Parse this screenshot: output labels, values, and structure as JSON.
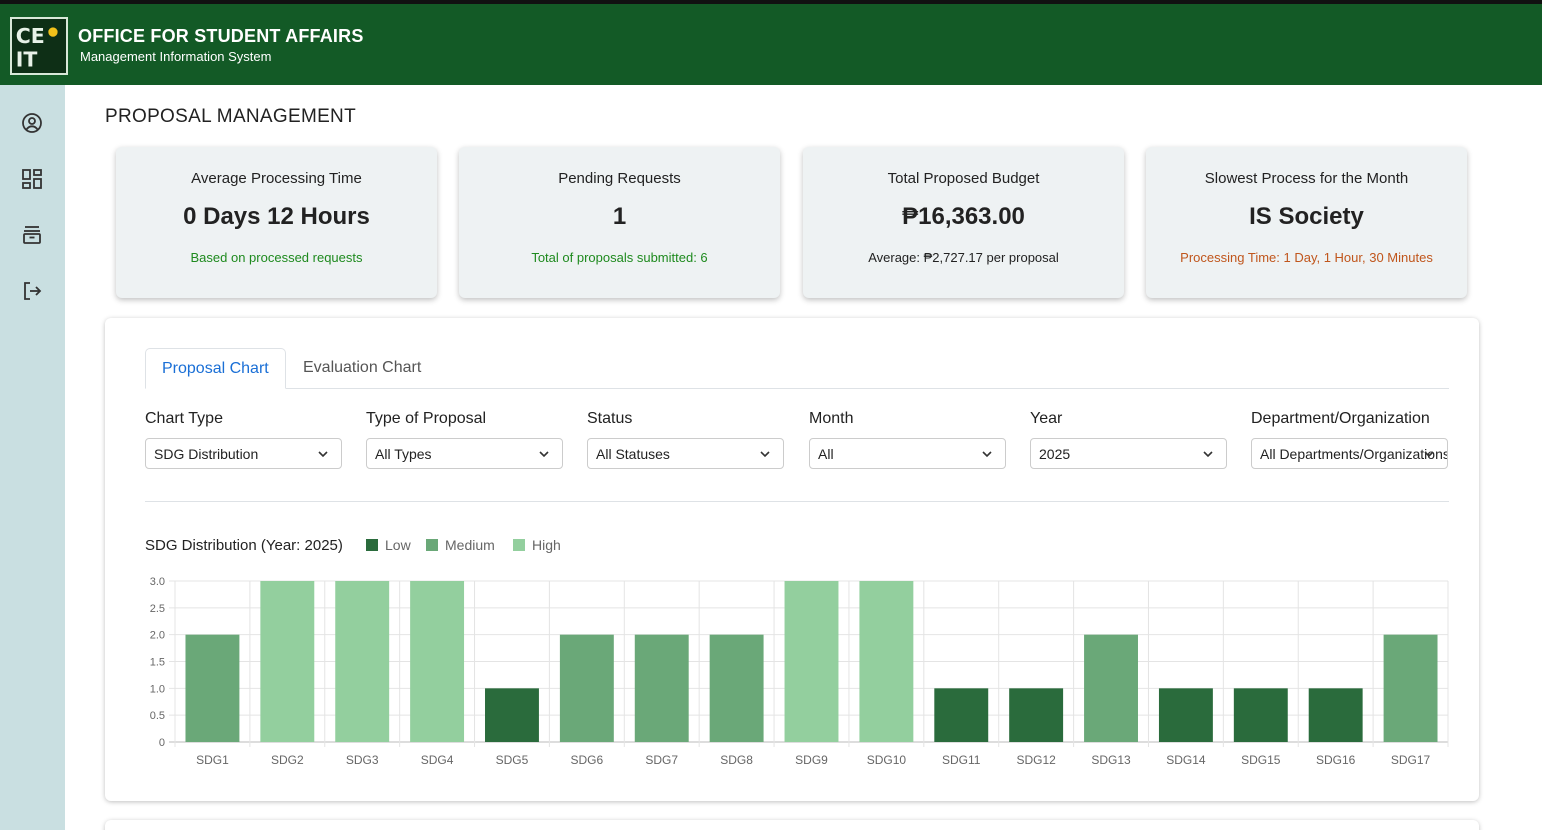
{
  "header": {
    "title": "OFFICE FOR STUDENT AFFAIRS",
    "subtitle": "Management Information System",
    "logo_text": "CEIT"
  },
  "sidebar": {
    "items": [
      {
        "icon": "user-circle-icon"
      },
      {
        "icon": "dashboard-grid-icon"
      },
      {
        "icon": "archive-box-icon"
      },
      {
        "icon": "logout-icon"
      }
    ]
  },
  "page": {
    "title": "PROPOSAL MANAGEMENT"
  },
  "cards": [
    {
      "label": "Average Processing Time",
      "value": "0 Days 12 Hours",
      "note": "Based on processed requests",
      "note_color": "#1e8a1e"
    },
    {
      "label": "Pending Requests",
      "value": "1",
      "note": "Total of proposals submitted: 6",
      "note_color": "#1e8a1e"
    },
    {
      "label": "Total Proposed Budget",
      "value": "₱16,363.00",
      "note": "Average: ₱2,727.17 per proposal",
      "note_color": "#222222"
    },
    {
      "label": "Slowest Process for the Month",
      "value": "IS Society",
      "note": "Processing Time: 1 Day, 1 Hour, 30 Minutes",
      "note_color": "#c0561c"
    }
  ],
  "tabs": [
    {
      "label": "Proposal Chart",
      "active": true
    },
    {
      "label": "Evaluation Chart",
      "active": false
    }
  ],
  "filters": [
    {
      "label": "Chart Type",
      "value": "SDG Distribution"
    },
    {
      "label": "Type of Proposal",
      "value": "All Types"
    },
    {
      "label": "Status",
      "value": "All Statuses"
    },
    {
      "label": "Month",
      "value": "All"
    },
    {
      "label": "Year",
      "value": "2025"
    },
    {
      "label": "Department/Organization",
      "value": "All Departments/Organizations"
    }
  ],
  "colors": {
    "header_bg": "#135a26",
    "sidebar_bg": "#c9dfe1",
    "active_tab": "#1a6fd6"
  },
  "chart_data": {
    "type": "bar",
    "title": "SDG Distribution (Year: 2025)",
    "legend_position": "top",
    "series_legend": [
      {
        "name": "Low",
        "color": "#2a6b3c"
      },
      {
        "name": "Medium",
        "color": "#6aa878"
      },
      {
        "name": "High",
        "color": "#93cf9e"
      }
    ],
    "categories": [
      "SDG1",
      "SDG2",
      "SDG3",
      "SDG4",
      "SDG5",
      "SDG6",
      "SDG7",
      "SDG8",
      "SDG9",
      "SDG10",
      "SDG11",
      "SDG12",
      "SDG13",
      "SDG14",
      "SDG15",
      "SDG16",
      "SDG17"
    ],
    "values": [
      2,
      3,
      3,
      3,
      1,
      2,
      2,
      2,
      3,
      3,
      1,
      1,
      2,
      1,
      1,
      1,
      2
    ],
    "levels": [
      "Medium",
      "High",
      "High",
      "High",
      "Low",
      "Medium",
      "Medium",
      "Medium",
      "High",
      "High",
      "Low",
      "Low",
      "Medium",
      "Low",
      "Low",
      "Low",
      "Medium"
    ],
    "y_ticks": [
      "0",
      "0.5",
      "1.0",
      "1.5",
      "2.0",
      "2.5",
      "3.0"
    ],
    "ylim": [
      0,
      3
    ],
    "grid": true
  }
}
